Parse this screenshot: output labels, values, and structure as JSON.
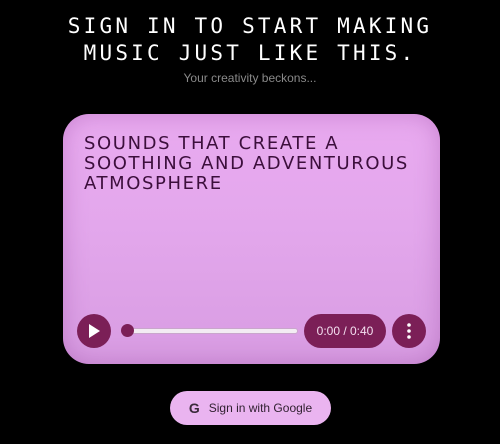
{
  "header": {
    "line1": "SIGN IN TO START MAKING",
    "line2": "MUSIC JUST LIKE THIS.",
    "subtitle": "Your creativity beckons..."
  },
  "card": {
    "description": "SOUNDS THAT CREATE A SOOTHING AND ADVENTUROUS ATMOSPHERE",
    "player": {
      "time": "0:00 / 0:40",
      "progress": 0
    }
  },
  "signin": {
    "icon": "G",
    "label": "Sign in with Google"
  },
  "colors": {
    "background": "#000000",
    "card": "#e3a7ec",
    "accent": "#7b1f57",
    "button": "#eab4f0"
  },
  "icons": {
    "play": "play-icon",
    "more": "more-vertical-icon",
    "google": "google-icon"
  }
}
